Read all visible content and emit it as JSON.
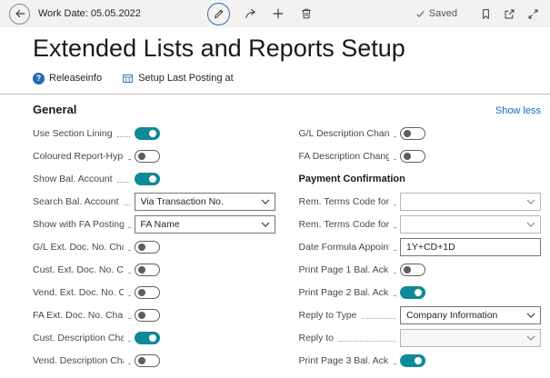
{
  "command_bar": {
    "work_date": "Work Date: 05.05.2022",
    "saved_label": "Saved",
    "center_icons": [
      "edit",
      "share",
      "new",
      "delete"
    ],
    "right_icons": [
      "bookmark",
      "open-in-window",
      "expand"
    ]
  },
  "page": {
    "title": "Extended Lists and Reports Setup"
  },
  "action_bar": {
    "items": [
      {
        "label": "Releaseinfo",
        "icon": "help-circle"
      },
      {
        "label": "Setup Last Posting at",
        "icon": "table"
      }
    ]
  },
  "general": {
    "title": "General",
    "show_less_label": "Show less",
    "left_fields": [
      {
        "label": "Use Section Lining",
        "type": "toggle",
        "value": true
      },
      {
        "label": "Coloured Report-Hyp...",
        "type": "toggle",
        "value": false
      },
      {
        "label": "Show Bal. Account",
        "type": "toggle",
        "value": true
      },
      {
        "label": "Search Bal. Account",
        "type": "select",
        "value": "Via Transaction No."
      },
      {
        "label": "Show with FA Postings",
        "type": "select",
        "value": "FA Name"
      },
      {
        "label": "G/L Ext. Doc. No. Cha...",
        "type": "toggle",
        "value": false
      },
      {
        "label": "Cust. Ext. Doc. No. Ch...",
        "type": "toggle",
        "value": false
      },
      {
        "label": "Vend. Ext. Doc. No. Ch...",
        "type": "toggle",
        "value": false
      },
      {
        "label": "FA Ext. Doc. No. Chan...",
        "type": "toggle",
        "value": false
      },
      {
        "label": "Cust. Description Cha...",
        "type": "toggle",
        "value": true
      },
      {
        "label": "Vend. Description Cha...",
        "type": "toggle",
        "value": false
      }
    ],
    "right_fields": [
      {
        "label": "G/L Description Chan...",
        "type": "toggle",
        "value": false
      },
      {
        "label": "FA Description Chang...",
        "type": "toggle",
        "value": false
      },
      {
        "label": "Payment Confirmation",
        "type": "subheading"
      },
      {
        "label": "Rem. Terms Code for ...",
        "type": "select",
        "value": ""
      },
      {
        "label": "Rem. Terms Code for ...",
        "type": "select",
        "value": ""
      },
      {
        "label": "Date Formula Appoint...",
        "type": "input",
        "value": "1Y+CD+1D"
      },
      {
        "label": "Print Page 1 Bal. Ack. ...",
        "type": "toggle",
        "value": false
      },
      {
        "label": "Print Page 2 Bal. Ack. ...",
        "type": "toggle",
        "value": true
      },
      {
        "label": "Reply to Type",
        "type": "select",
        "value": "Company Information"
      },
      {
        "label": "Reply to",
        "type": "select",
        "value": "",
        "disabled": true
      },
      {
        "label": "Print Page 3 Bal. Ack. ...",
        "type": "toggle",
        "value": true
      }
    ]
  },
  "colors": {
    "toggle_on": "#0e8a98",
    "link_blue": "#0f6cbd",
    "edit_ring_blue": "#2a6ebb",
    "help_icon_blue": "#1d6ab4"
  }
}
